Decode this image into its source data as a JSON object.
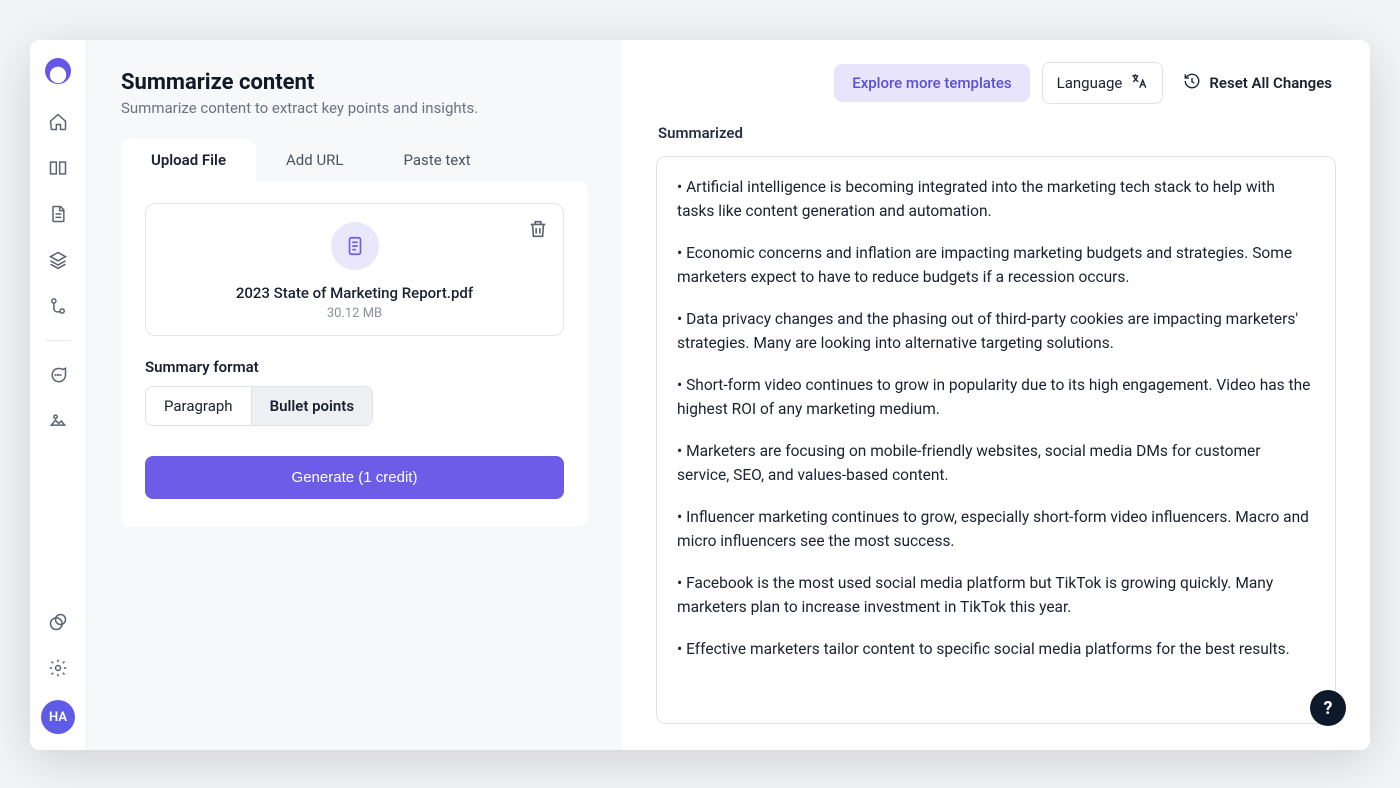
{
  "sidebar": {
    "avatar_initials": "HA"
  },
  "header": {
    "title": "Summarize content",
    "subtitle": "Summarize content to extract key points and insights."
  },
  "tabs": [
    {
      "label": "Upload File",
      "active": true
    },
    {
      "label": "Add URL",
      "active": false
    },
    {
      "label": "Paste text",
      "active": false
    }
  ],
  "upload": {
    "file_name": "2023 State of Marketing Report.pdf",
    "file_size": "30.12 MB"
  },
  "format": {
    "label": "Summary format",
    "options": [
      {
        "label": "Paragraph",
        "active": false
      },
      {
        "label": "Bullet points",
        "active": true
      }
    ]
  },
  "generate_button": "Generate (1 credit)",
  "topbar": {
    "explore": "Explore more templates",
    "language": "Language",
    "reset": "Reset All Changes"
  },
  "output": {
    "title": "Summarized",
    "bullets": [
      "Artificial intelligence is becoming integrated into the marketing tech stack to help with tasks like content generation and automation.",
      "Economic concerns and inflation are impacting marketing budgets and strategies. Some marketers expect to have to reduce budgets if a recession occurs.",
      "Data privacy changes and the phasing out of third-party cookies are impacting marketers' strategies. Many are looking into alternative targeting solutions.",
      "Short-form video continues to grow in popularity due to its high engagement. Video has the highest ROI of any marketing medium.",
      "Marketers are focusing on mobile-friendly websites, social media DMs for customer service, SEO, and values-based content.",
      "Influencer marketing continues to grow, especially short-form video influencers. Macro and micro influencers see the most success.",
      "Facebook is the most used social media platform but TikTok is growing quickly. Many marketers plan to increase investment in TikTok this year.",
      "Effective marketers tailor content to specific social media platforms for the best results."
    ]
  },
  "help_fab": "?"
}
